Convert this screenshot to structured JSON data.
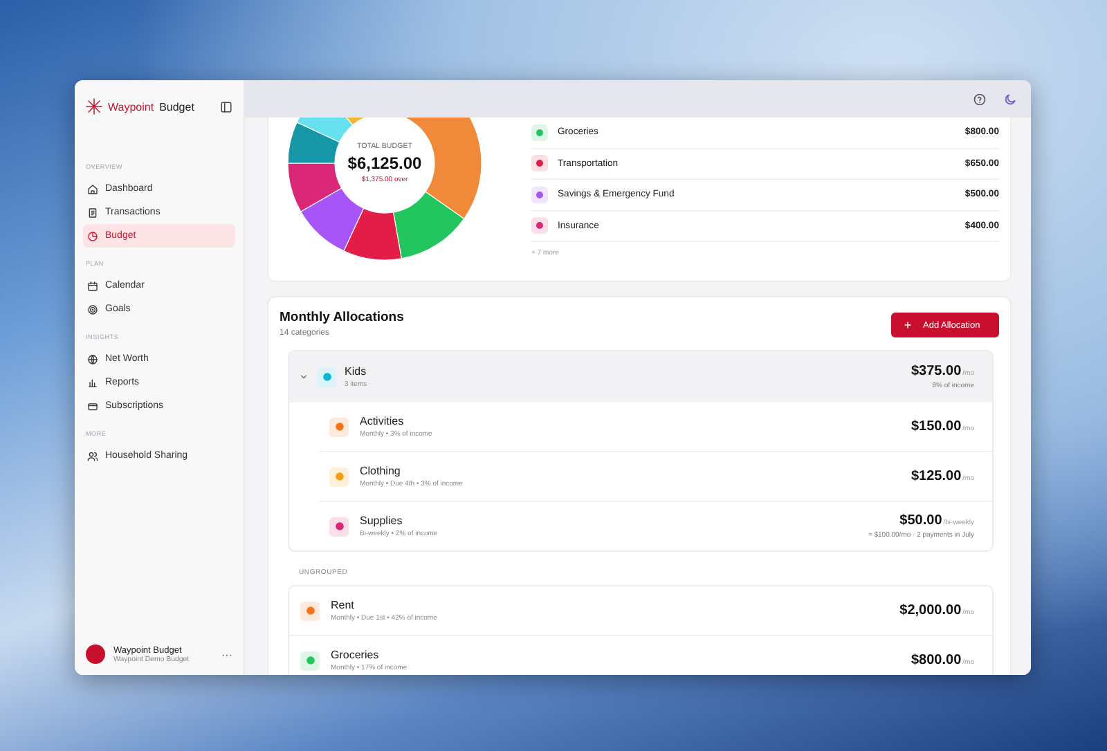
{
  "app": {
    "brand_first": "Waypoint",
    "brand_second": "Budget"
  },
  "sidebar": {
    "sections": [
      {
        "heading": "OVERVIEW",
        "items": [
          {
            "label": "Dashboard",
            "selected": false
          },
          {
            "label": "Transactions",
            "selected": false
          },
          {
            "label": "Budget",
            "selected": true
          }
        ]
      },
      {
        "heading": "PLAN",
        "items": [
          {
            "label": "Calendar",
            "selected": false
          },
          {
            "label": "Goals",
            "selected": false
          }
        ]
      },
      {
        "heading": "INSIGHTS",
        "items": [
          {
            "label": "Net Worth",
            "selected": false
          },
          {
            "label": "Reports",
            "selected": false
          },
          {
            "label": "Subscriptions",
            "selected": false
          }
        ]
      },
      {
        "heading": "MORE",
        "items": [
          {
            "label": "Household Sharing",
            "selected": false
          }
        ]
      }
    ],
    "account": {
      "name": "Waypoint Budget",
      "subtitle": "Waypoint Demo Budget",
      "menu": "···"
    }
  },
  "summary": {
    "label": "TOTAL BUDGET",
    "amount": "$6,125.00",
    "status": "$1,375.00 over",
    "categories": [
      {
        "name": "Groceries",
        "amount": "$800.00",
        "color": "#22c55e"
      },
      {
        "name": "Transportation",
        "amount": "$650.00",
        "color": "#e11d48"
      },
      {
        "name": "Savings & Emergency Fund",
        "amount": "$500.00",
        "color": "#a855f7"
      },
      {
        "name": "Insurance",
        "amount": "$400.00",
        "color": "#db2777"
      }
    ],
    "more": "+ 7 more"
  },
  "allocations": {
    "title": "Monthly Allocations",
    "subtitle": "14 categories",
    "add_button": "Add Allocation",
    "groups": [
      {
        "name": "Kids",
        "count": "3 items",
        "amount": "$375.00",
        "unit": "/mo",
        "note": "8% of income",
        "expanded": true,
        "color": "#06b6d4",
        "items": [
          {
            "name": "Activities",
            "detail": "Monthly • 3% of income",
            "amount": "$150.00",
            "unit": "/mo",
            "color": "#f97316"
          },
          {
            "name": "Clothing",
            "detail": "Monthly • Due 4th • 3% of income",
            "amount": "$125.00",
            "unit": "/mo",
            "color": "#f59e0b"
          },
          {
            "name": "Supplies",
            "detail": "Bi-weekly • 2% of income",
            "amount": "$50.00",
            "unit": "/bi-weekly",
            "note": "≈ $100.00/mo · 2 payments in July",
            "color": "#db2777"
          }
        ]
      }
    ],
    "ungrouped_label": "UNGROUPED",
    "ungrouped": [
      {
        "name": "Rent",
        "detail": "Monthly • Due 1st • 42% of income",
        "amount": "$2,000.00",
        "unit": "/mo",
        "color": "#f97316"
      },
      {
        "name": "Groceries",
        "detail": "Monthly • 17% of income",
        "amount": "$800.00",
        "unit": "/mo",
        "color": "#22c55e"
      }
    ]
  }
}
